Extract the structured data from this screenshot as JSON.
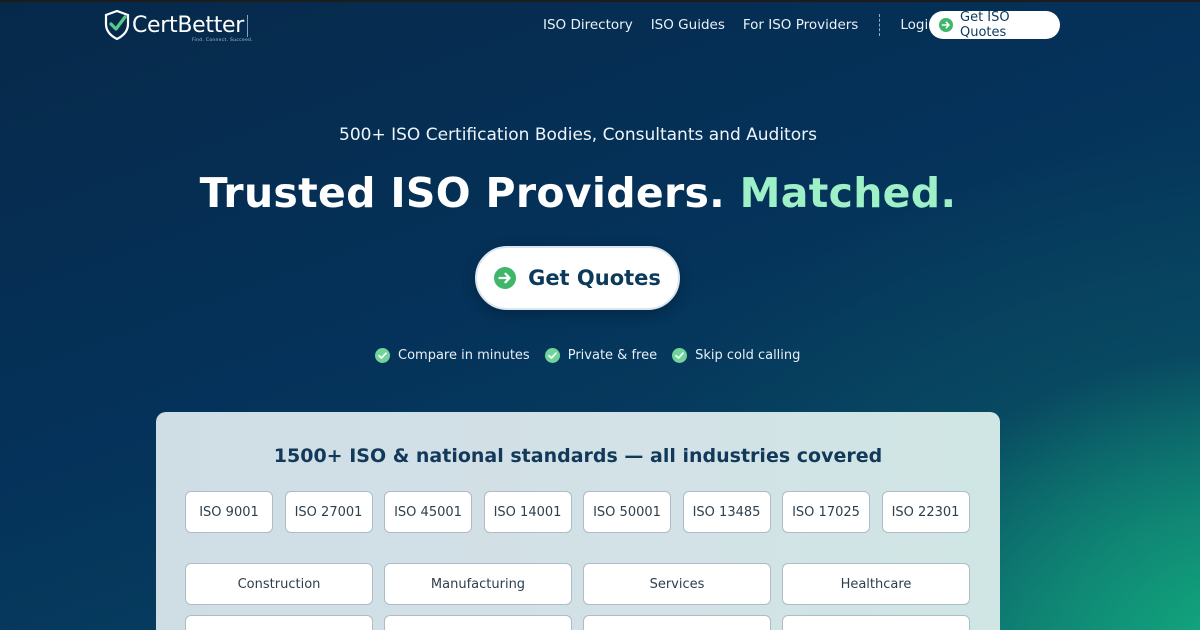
{
  "nav": {
    "logo_text": "CertBetter",
    "logo_tagline": "Find. Connect. Succeed.",
    "links": [
      "ISO Directory",
      "ISO Guides",
      "For ISO Providers"
    ],
    "login": "Login",
    "cta": "Get ISO Quotes"
  },
  "hero": {
    "subtitle": "500+ ISO Certification Bodies, Consultants and Auditors",
    "title_main": "Trusted ISO Providers.",
    "title_accent": "Matched.",
    "cta": "Get Quotes",
    "benefits": [
      "Compare in minutes",
      "Private & free",
      "Skip cold calling"
    ]
  },
  "panel": {
    "title": "1500+ ISO & national standards — all industries covered",
    "standards": [
      "ISO 9001",
      "ISO 27001",
      "ISO 45001",
      "ISO 14001",
      "ISO 50001",
      "ISO 13485",
      "ISO 17025",
      "ISO 22301"
    ],
    "industries": [
      "Construction",
      "Manufacturing",
      "Services",
      "Healthcare"
    ],
    "industries_row2": [
      "",
      "",
      "",
      ""
    ]
  },
  "colors": {
    "brand_navy": "#0b3a5c",
    "accent_mint": "#9ef0c7",
    "check_green": "#6fd39a",
    "arrow_green": "#3fb76a"
  },
  "icons": {
    "logo": "shield-check-icon",
    "cta": "arrow-right-circle-icon",
    "benefit": "check-circle-icon"
  }
}
